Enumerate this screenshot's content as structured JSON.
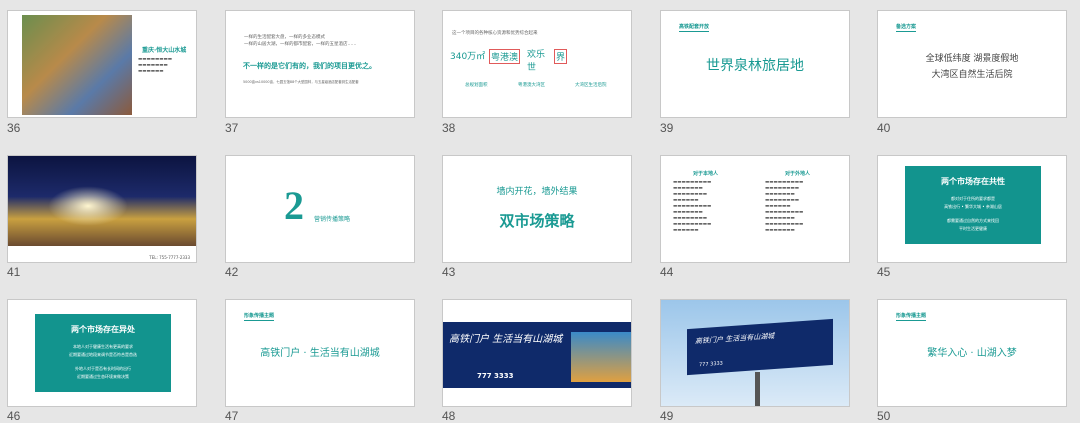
{
  "slides": [
    {
      "number": "36",
      "title": "重庆·恒大山水城"
    },
    {
      "number": "37",
      "line1": "一样的生活配套大盘，一样的多业态模式",
      "line2": "一样的山居大湖，一样的都市配套，一样的五星酒店……",
      "heading": "不一样的是它们有的，我们的项目更优之。",
      "footer": "5000亩vs10000亩，七园五馆88个大型园林，与五星级酒店配套到生活配套",
      "title": ""
    },
    {
      "number": "38",
      "intro": "这一个项目的各种核心资源和优势综合起来",
      "note": "",
      "words": [
        "340万㎡",
        "粤港澳",
        "欢乐",
        "世",
        "界"
      ],
      "labels": [
        "总规划面积",
        "粤港澳大湾区",
        "大湾区生活后院"
      ]
    },
    {
      "number": "39",
      "header": "高铁配套开放",
      "title": "世界泉林旅居地"
    },
    {
      "number": "40",
      "header": "备选方案",
      "line1": "全球低纬度  湖景度假地",
      "line2": "大湾区自然生活后院"
    },
    {
      "number": "41",
      "phone": "TEL: 755-7777-2333"
    },
    {
      "number": "42",
      "big": "2",
      "caption": "营销传播策略"
    },
    {
      "number": "43",
      "line1": "墙内开花，墙外结果",
      "line2": "双市场策略"
    },
    {
      "number": "44",
      "col1_title": "对于本地人",
      "col2_title": "对于外地人"
    },
    {
      "number": "45",
      "title": "两个市场存在共性",
      "sub1": "都对对于住所的要求都是",
      "sub2": "高铁出行 • 繁华大城 • 亲湖山居",
      "sub3": "都需要通过自然的方式来找回",
      "sub4": "平时生活更健康"
    },
    {
      "number": "46",
      "title": "两个市场存在异处",
      "sub1": "本地人对于健康生活有更高的要求",
      "sub2": "近期要通过地段来调节是否符合是首选",
      "sub3": "外地人对于是否有长时间的出行",
      "sub4": "近期要通过生态环境来做决策"
    },
    {
      "number": "47",
      "header": "形象传播主题",
      "title": "高铁门户 · 生活当有山湖城"
    },
    {
      "number": "48",
      "slogan": "高铁门户 生活当有山湖城",
      "phone": "777 3333"
    },
    {
      "number": "49",
      "slogan": "高铁门户 生活当有山湖城",
      "phone": "777 3333"
    },
    {
      "number": "50",
      "header": "形象传播主题",
      "title": "繁华入心 · 山湖入梦"
    }
  ]
}
